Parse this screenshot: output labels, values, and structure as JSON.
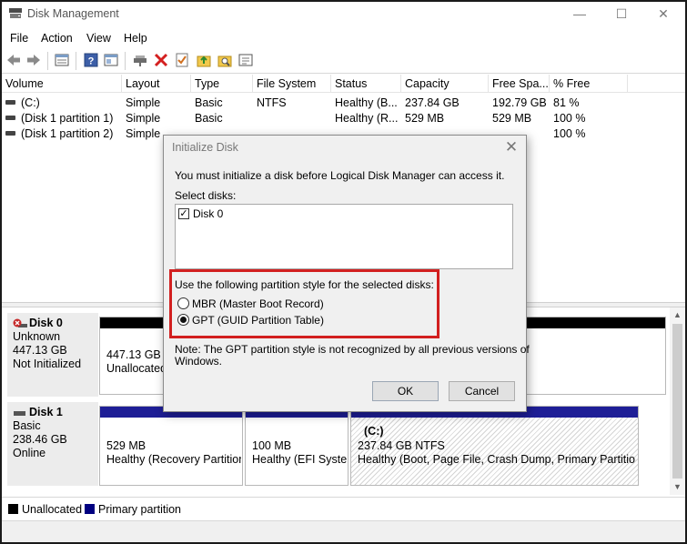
{
  "window": {
    "title": "Disk Management",
    "controls": {
      "minimize": "—",
      "maximize": "☐",
      "close": "✕"
    }
  },
  "menu": [
    "File",
    "Action",
    "View",
    "Help"
  ],
  "toolbar_icons": [
    "back-arrow-icon",
    "forward-arrow-icon",
    "list-view-icon",
    "help-icon",
    "console-icon",
    "connect-icon",
    "delete-icon",
    "check-icon",
    "up-folder-icon",
    "search-folder-icon",
    "properties-icon"
  ],
  "volume_table": {
    "columns": [
      "Volume",
      "Layout",
      "Type",
      "File System",
      "Status",
      "Capacity",
      "Free Spa...",
      "% Free"
    ],
    "rows": [
      [
        "(C:)",
        "Simple",
        "Basic",
        "NTFS",
        "Healthy (B...",
        "237.84 GB",
        "192.79 GB",
        "81 %"
      ],
      [
        "(Disk 1 partition 1)",
        "Simple",
        "Basic",
        "",
        "Healthy (R...",
        "529 MB",
        "529 MB",
        "100 %"
      ],
      [
        "(Disk 1 partition 2)",
        "Simple",
        "",
        "",
        "",
        "",
        "",
        "100 %"
      ]
    ]
  },
  "disks": [
    {
      "name": "Disk 0",
      "type": "Unknown",
      "size": "447.13 GB",
      "state": "Not Initialized",
      "partitions": [
        {
          "size": "447.13 GB",
          "status": "Unallocated"
        }
      ]
    },
    {
      "name": "Disk 1",
      "type": "Basic",
      "size": "238.46 GB",
      "state": "Online",
      "partitions": [
        {
          "size": "529 MB",
          "status": "Healthy (Recovery Partition"
        },
        {
          "size": "100 MB",
          "status": "Healthy (EFI System"
        },
        {
          "label": "(C:)",
          "size": "237.84 GB NTFS",
          "status": "Healthy (Boot, Page File, Crash Dump, Primary Partition)"
        }
      ]
    }
  ],
  "legend": [
    {
      "label": "Unallocated",
      "color": "#000000"
    },
    {
      "label": "Primary partition",
      "color": "#000080"
    }
  ],
  "colors": {
    "unallocated": "#000000",
    "primary": "#00008b",
    "partition_bar": "#1e1e96",
    "highlight": "#d21f1f",
    "disk_error": "#c62828"
  },
  "dialog": {
    "title": "Initialize Disk",
    "close": "✕",
    "message": "You must initialize a disk before Logical Disk Manager can access it.",
    "select_label": "Select disks:",
    "disk_items": [
      {
        "label": "Disk 0",
        "checked": true
      }
    ],
    "style_label": "Use the following partition style for the selected disks:",
    "options": [
      {
        "label": "MBR (Master Boot Record)",
        "selected": false
      },
      {
        "label": "GPT (GUID Partition Table)",
        "selected": true
      }
    ],
    "note_line1": "Note: The GPT partition style is not recognized by all previous versions of",
    "note_line2": "Windows.",
    "ok": "OK",
    "cancel": "Cancel"
  }
}
